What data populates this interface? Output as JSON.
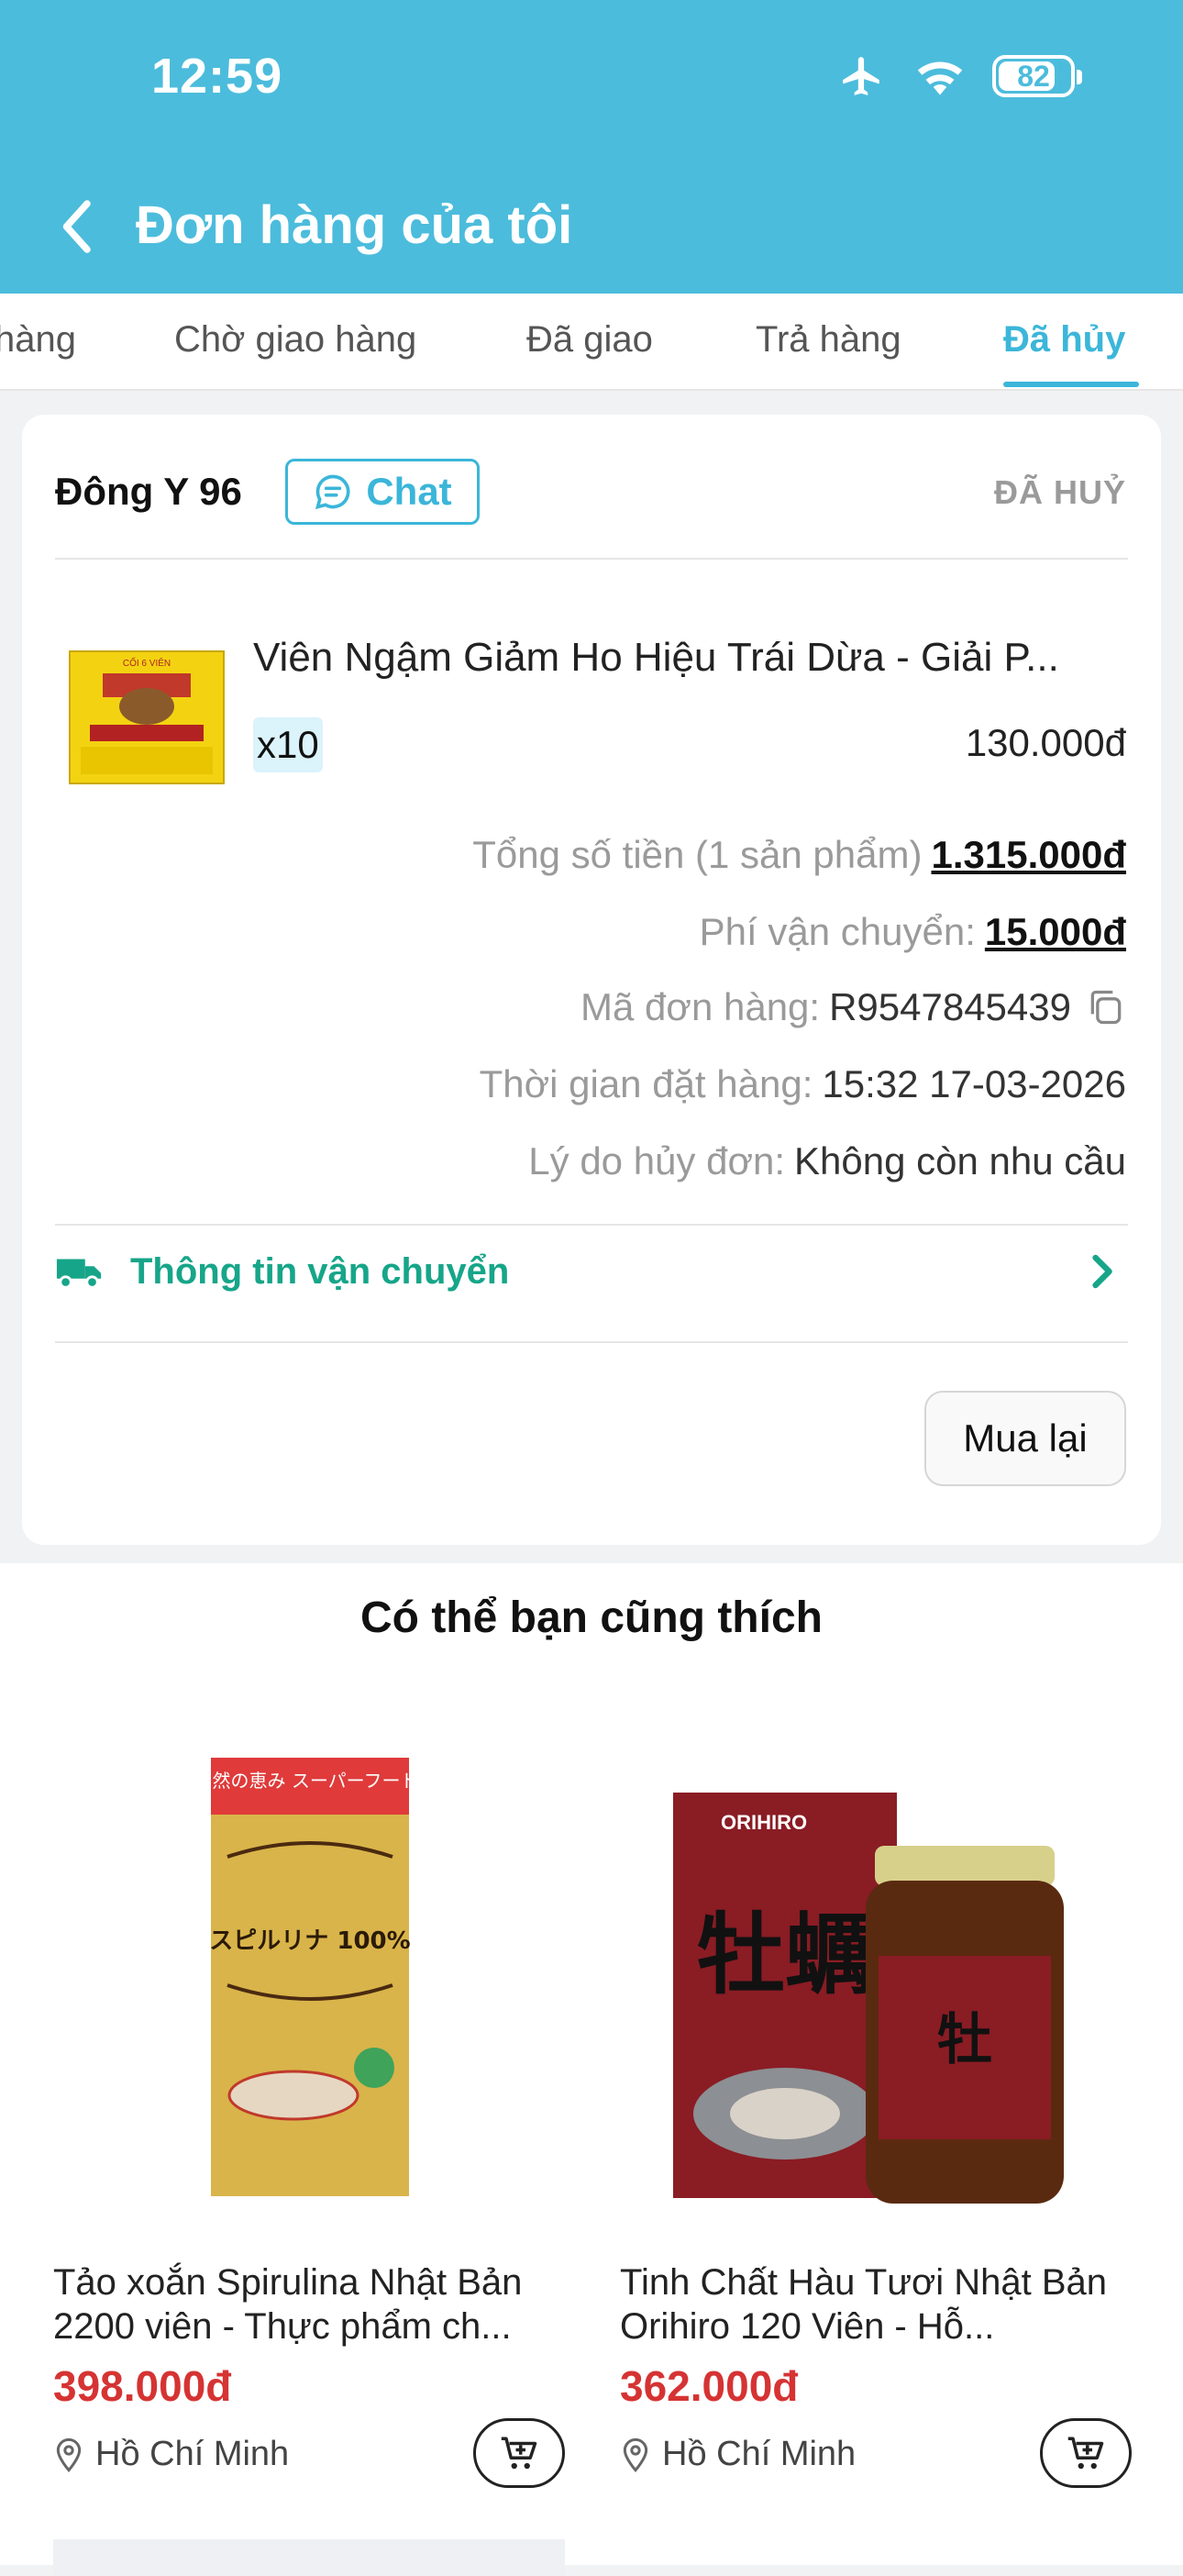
{
  "status_bar": {
    "time": "12:59",
    "battery": "82"
  },
  "header": {
    "title": "Đơn hàng của tôi"
  },
  "tabs": [
    {
      "label": "hàng"
    },
    {
      "label": "Chờ giao hàng"
    },
    {
      "label": "Đã giao"
    },
    {
      "label": "Trả hàng"
    },
    {
      "label": "Đã hủy"
    }
  ],
  "order": {
    "shop_name": "Đông Y 96",
    "chat_label": "Chat",
    "status": "ĐÃ HUỶ",
    "product": {
      "name": "Viên Ngậm Giảm Ho Hiệu Trái Dừa - Giải P...",
      "quantity": "x10",
      "price": "130.000đ"
    },
    "total_label": "Tổng số tiền (1 sản phẩm)",
    "total_value": "1.315.000đ",
    "shipping_fee_label": "Phí vận chuyển:",
    "shipping_fee_value": "15.000đ",
    "order_code_label": "Mã đơn hàng:",
    "order_code_value": "R9547845439",
    "order_time_label": "Thời gian đặt hàng:",
    "order_time_value": "15:32 17-03-2026",
    "cancel_reason_label": "Lý do hủy đơn:",
    "cancel_reason_value": "Không còn nhu cầu",
    "shipping_info_label": "Thông tin vận chuyển",
    "rebuy_label": "Mua lại"
  },
  "recommendations": {
    "title": "Có thể bạn cũng thích",
    "items": [
      {
        "name": "Tảo xoắn Spirulina Nhật Bản 2200 viên - Thực phẩm ch...",
        "price": "398.000đ",
        "location": "Hồ Chí Minh",
        "image_text_top": "自然の恵み スーパーフード!",
        "image_text_main": "スピルリナ 100%"
      },
      {
        "name": "Tinh Chất Hàu Tươi Nhật Bản Orihiro 120 Viên - Hỗ...",
        "price": "362.000đ",
        "location": "Hồ Chí Minh",
        "image_text_brand": "ORIHIRO",
        "image_text_main": "牡蠣"
      }
    ]
  },
  "colors": {
    "brand": "#4cbcdc",
    "accent": "#3bb6d9",
    "price": "#d63333",
    "shipping": "#17a589"
  }
}
